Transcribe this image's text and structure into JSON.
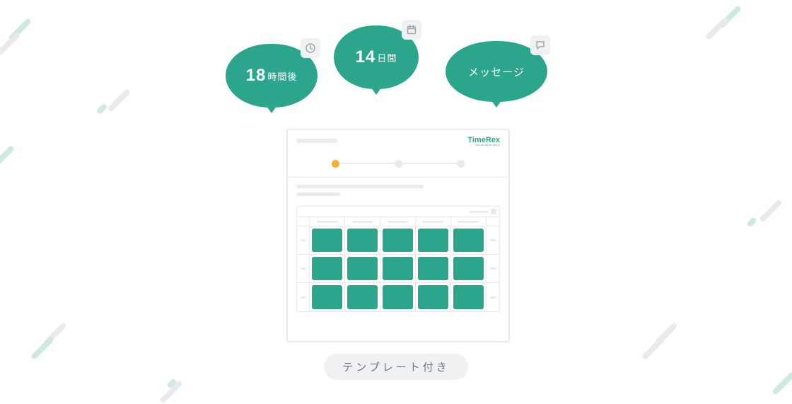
{
  "bubbles": {
    "time": {
      "number": "18",
      "suffix": "時間後"
    },
    "days": {
      "number": "14",
      "suffix": "日間"
    },
    "message": {
      "text": "メッセージ"
    }
  },
  "panel": {
    "brand": "TimeRex",
    "brand_sub": "PRODUCED BY MIXIN"
  },
  "template_badge": "テンプレート付き"
}
